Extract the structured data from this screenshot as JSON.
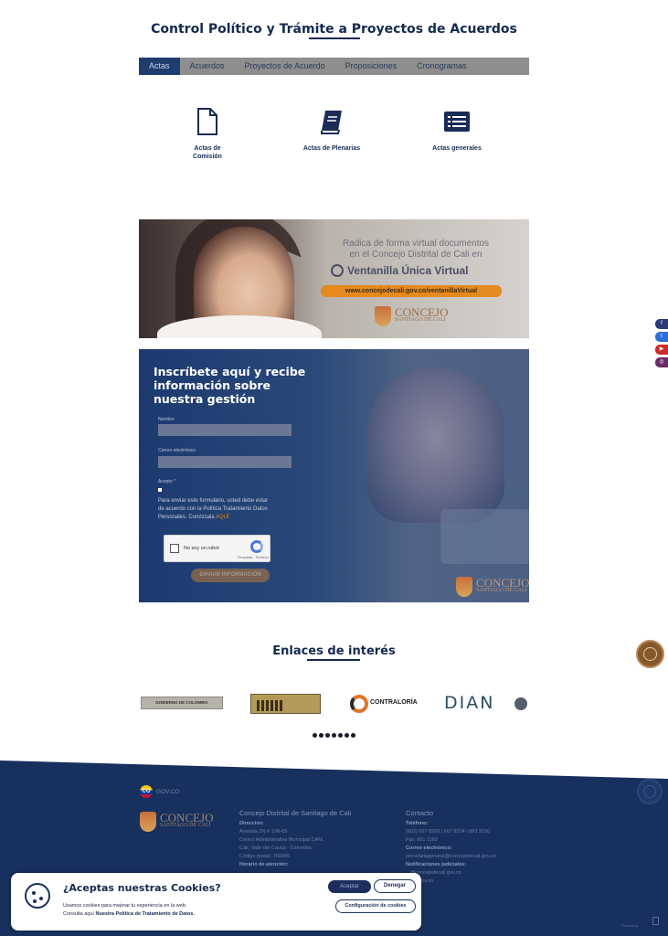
{
  "header": {
    "title": "Control Político y Trámite a Proyectos de Acuerdos"
  },
  "tabs": [
    {
      "label": "Actas",
      "active": true
    },
    {
      "label": "Acuerdos",
      "active": false
    },
    {
      "label": "Proyectos de Acuerdo",
      "active": false
    },
    {
      "label": "Proposiciones",
      "active": false
    },
    {
      "label": "Cronogramas",
      "active": false
    }
  ],
  "acts": [
    {
      "label_line1": "Actas de",
      "label_line2": "Comisión",
      "icon": "document-icon"
    },
    {
      "label_line1": "Actas de Plenarias",
      "label_line2": "",
      "icon": "book-icon"
    },
    {
      "label_line1": "Actas generales",
      "label_line2": "",
      "icon": "list-icon"
    }
  ],
  "banner": {
    "line1": "Radica de forma virtual documentos",
    "line2": "en el Concejo Distrital de Cali en",
    "brand": "Ventanilla Única Virtual",
    "url": "www.concejodecali.gov.co/ventanillaVirtual",
    "logo_big": "CONCEJO",
    "logo_small": "SANTIAGO DE CALI"
  },
  "form": {
    "heading_line1": "Inscríbete aquí y recibe",
    "heading_line2": "información sobre",
    "heading_line3": "nuestra gestión",
    "name_label": "Nombre",
    "email_label": "Correo electrónico",
    "accept_label": "Acepto *",
    "note_line1": "Para enviar este formulario, usted debe estar",
    "note_line2": "de acuerdo con la Política Tratamiento Datos",
    "note_line3": "Personales. Conózcala",
    "note_link": "AQUÍ",
    "recaptcha_label": "No soy un robot",
    "recaptcha_small": "Privacidad · Términos",
    "submit_label": "ENVIAR INFORMACIÓN",
    "logo_big": "CONCEJO",
    "logo_small": "SANTIAGO DE CALI"
  },
  "social": [
    {
      "label": "f",
      "color": "#2c3a78"
    },
    {
      "label": "t",
      "color": "#2c6fd8"
    },
    {
      "label": "▶",
      "color": "#d02a2a"
    },
    {
      "label": "◎",
      "color": "#6a2b68"
    }
  ],
  "links": {
    "title": "Enlaces de interés",
    "gov_text": "GOBIERNO DE COLOMBIA",
    "contraloria_text": "CONTRALORÍA",
    "dian_text": "DIAN",
    "dot_count": 7
  },
  "footer": {
    "gov_label": "GOV.CO",
    "co_label": "CO",
    "logo_big": "CONCEJO",
    "logo_small": "SANTIAGO DE CALI",
    "org_name": "Concejo Distrital de Santiago de Cali",
    "address_label": "Dirección:",
    "address_line1": "Avenida 2N # 10N-65",
    "address_line2": "Centro Administrativo Municipal CAM,",
    "address_line3": "Cali, Valle del Cauca - Colombia",
    "postal": "Código postal: 760045",
    "hours_label": "Horario de atención:",
    "contact_title": "Contacto",
    "phone_label": "Teléfono:",
    "phone": "(602) 667 8200 | 667 8334 | 883 3150",
    "fax": "Fax: 661 1160",
    "email_label": "Correo electrónico:",
    "email": "secretariageneral@concejodecali.gov.co",
    "judicial_label": "Notificaciones judiciales:",
    "judicial": "...@concejodecali.gov.co",
    "extra": "...cali.gov.co",
    "bottom_mark": "Powered by"
  },
  "cookie": {
    "title": "¿Aceptas nuestras Cookies?",
    "body_line1": "Usamos cookies para mejorar tu experiencia en la web.",
    "body_line2_prefix": "Consulta aquí",
    "body_line2_link": "Nuestra Política de Tratamiento de Datos.",
    "accept": "Aceptar",
    "deny": "Denegar",
    "config": "Configuración de cookies"
  }
}
